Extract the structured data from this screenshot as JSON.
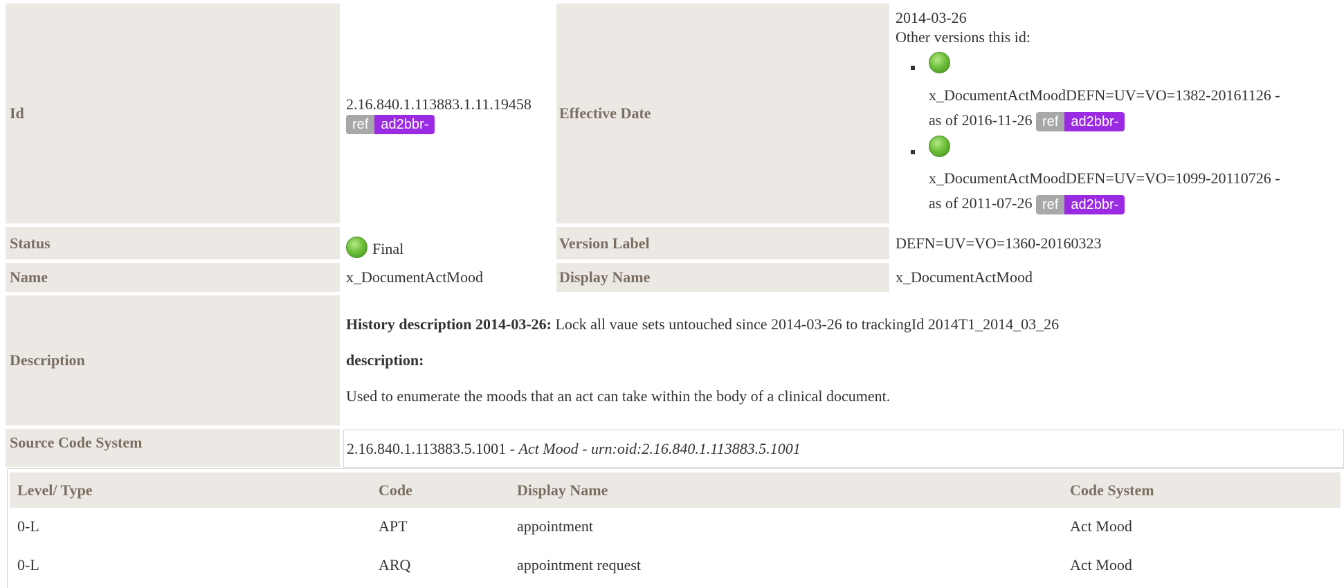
{
  "id_row": {
    "label": "Id",
    "value": "2.16.840.1.113883.1.11.19458",
    "badge_ref": "ref",
    "badge_tag": "ad2bbr-",
    "effective_label": "Effective Date",
    "effective_date": "2014-03-26",
    "other_versions_label": "Other versions this id:",
    "versions": [
      {
        "name": "x_DocumentActMoodDEFN=UV=VO=1382-20161126 -",
        "asof": "as of 2016-11-26",
        "badge_ref": "ref",
        "badge_tag": "ad2bbr-"
      },
      {
        "name": "x_DocumentActMoodDEFN=UV=VO=1099-20110726 -",
        "asof": "as of 2011-07-26",
        "badge_ref": "ref",
        "badge_tag": "ad2bbr-"
      }
    ]
  },
  "status_row": {
    "label": "Status",
    "value": "Final",
    "version_label": "Version Label",
    "version_value": "DEFN=UV=VO=1360-20160323"
  },
  "name_row": {
    "label": "Name",
    "value": "x_DocumentActMood",
    "display_label": "Display Name",
    "display_value": "x_DocumentActMood"
  },
  "description_row": {
    "label": "Description",
    "history_heading": "History description 2014-03-26:",
    "history_text": "Lock all vaue sets untouched since 2014-03-26 to trackingId 2014T1_2014_03_26",
    "desc_heading": "description:",
    "desc_text": "Used to enumerate the moods that an act can take within the body of a clinical document."
  },
  "source_row": {
    "label": "Source Code System",
    "oid": "2.16.840.1.113883.5.1001",
    "sep1": " - ",
    "name": "Act Mood",
    "sep2": " - ",
    "urn": "urn:oid:2.16.840.1.113883.5.1001"
  },
  "concept_table": {
    "headers": [
      "Level/ Type",
      "Code",
      "Display Name",
      "Code System"
    ],
    "rows": [
      [
        "0-L",
        "APT",
        "appointment",
        "Act Mood"
      ],
      [
        "0-L",
        "ARQ",
        "appointment request",
        "Act Mood"
      ]
    ]
  },
  "colors": {
    "label_bg": "#ece9e4",
    "label_text": "#7a6e61",
    "badge_ref": "#a8a8a8",
    "badge_tag": "#9a2be2",
    "status_dot": "#6fc03a"
  },
  "icons": {
    "status": "green-circle-icon"
  }
}
